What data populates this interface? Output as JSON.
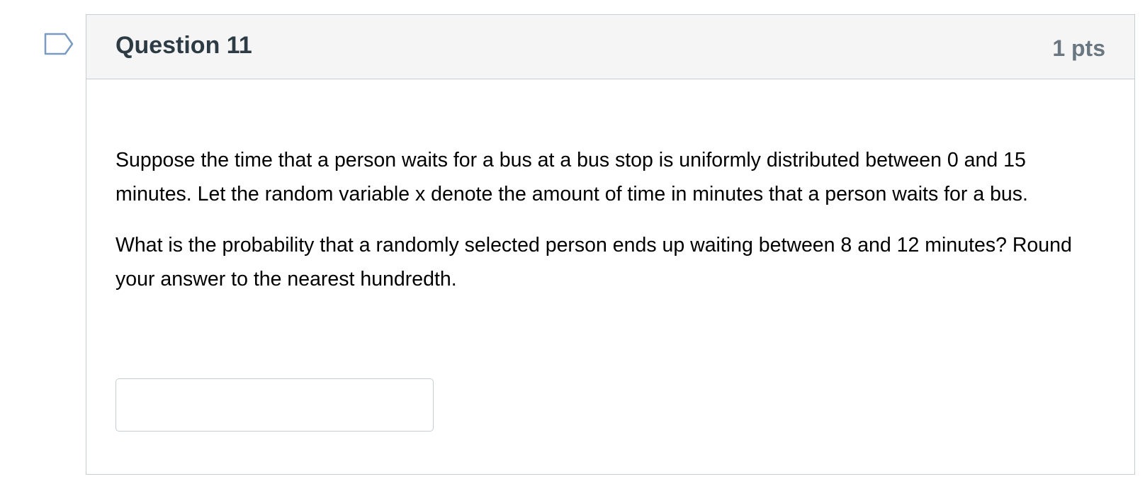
{
  "question": {
    "title": "Question 11",
    "points": "1 pts",
    "flag_icon": "bookmark-flag-icon",
    "paragraphs": [
      "Suppose the time that a person waits for a bus at a bus stop is uniformly distributed between 0 and 15 minutes.  Let the random variable x denote the amount of time in minutes that a person waits for a bus.",
      "What is the probability that a randomly selected person ends up waiting between 8 and 12 minutes?  Round your answer to the nearest hundredth."
    ],
    "answer": {
      "value": "",
      "placeholder": ""
    }
  },
  "colors": {
    "header_bg": "#f5f5f5",
    "border": "#c7cdd1",
    "title_text": "#2d3b45",
    "points_text": "#6b7780",
    "flag_stroke": "#7a9bbf"
  }
}
